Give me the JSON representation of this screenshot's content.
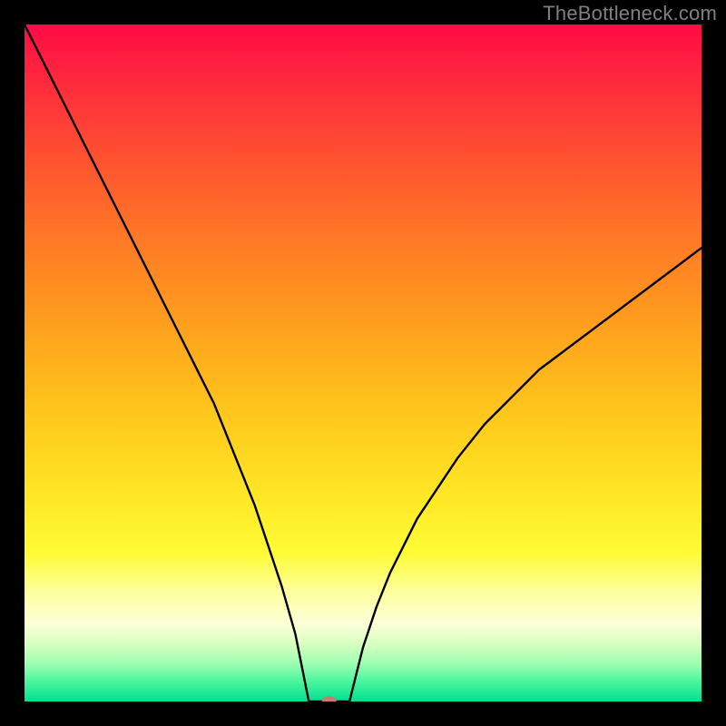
{
  "watermark": "TheBottleneck.com",
  "chart_data": {
    "type": "line",
    "title": "",
    "xlabel": "",
    "ylabel": "",
    "xlim": [
      0,
      100
    ],
    "ylim": [
      0,
      100
    ],
    "marker": {
      "x": 45,
      "y": 0,
      "color": "#cc7a6f",
      "rx": 8,
      "ry": 6
    },
    "flat_region_x": [
      42,
      48
    ],
    "curve_left": [
      {
        "x": 0,
        "y": 100
      },
      {
        "x": 2,
        "y": 96
      },
      {
        "x": 4,
        "y": 92
      },
      {
        "x": 6,
        "y": 88
      },
      {
        "x": 8,
        "y": 84
      },
      {
        "x": 10,
        "y": 80
      },
      {
        "x": 12,
        "y": 76
      },
      {
        "x": 14,
        "y": 72
      },
      {
        "x": 16,
        "y": 68
      },
      {
        "x": 18,
        "y": 64
      },
      {
        "x": 20,
        "y": 60
      },
      {
        "x": 22,
        "y": 56
      },
      {
        "x": 24,
        "y": 52
      },
      {
        "x": 26,
        "y": 48
      },
      {
        "x": 28,
        "y": 44
      },
      {
        "x": 30,
        "y": 39
      },
      {
        "x": 32,
        "y": 34
      },
      {
        "x": 34,
        "y": 29
      },
      {
        "x": 36,
        "y": 23
      },
      {
        "x": 38,
        "y": 17
      },
      {
        "x": 40,
        "y": 10
      },
      {
        "x": 42,
        "y": 0
      }
    ],
    "curve_right": [
      {
        "x": 48,
        "y": 0
      },
      {
        "x": 50,
        "y": 8
      },
      {
        "x": 52,
        "y": 14
      },
      {
        "x": 54,
        "y": 19
      },
      {
        "x": 56,
        "y": 23
      },
      {
        "x": 58,
        "y": 27
      },
      {
        "x": 60,
        "y": 30
      },
      {
        "x": 62,
        "y": 33
      },
      {
        "x": 64,
        "y": 36
      },
      {
        "x": 66,
        "y": 38.5
      },
      {
        "x": 68,
        "y": 41
      },
      {
        "x": 70,
        "y": 43
      },
      {
        "x": 72,
        "y": 45
      },
      {
        "x": 74,
        "y": 47
      },
      {
        "x": 76,
        "y": 49
      },
      {
        "x": 78,
        "y": 50.5
      },
      {
        "x": 80,
        "y": 52
      },
      {
        "x": 82,
        "y": 53.5
      },
      {
        "x": 84,
        "y": 55
      },
      {
        "x": 86,
        "y": 56.5
      },
      {
        "x": 88,
        "y": 58
      },
      {
        "x": 90,
        "y": 59.5
      },
      {
        "x": 92,
        "y": 61
      },
      {
        "x": 94,
        "y": 62.5
      },
      {
        "x": 96,
        "y": 64
      },
      {
        "x": 98,
        "y": 65.5
      },
      {
        "x": 100,
        "y": 67
      }
    ],
    "gradient_stops": [
      {
        "offset": 0.0,
        "color": "#ff0b46"
      },
      {
        "offset": 0.1,
        "color": "#ff2f3b"
      },
      {
        "offset": 0.2,
        "color": "#ff5230"
      },
      {
        "offset": 0.3,
        "color": "#ff7327"
      },
      {
        "offset": 0.4,
        "color": "#ff9220"
      },
      {
        "offset": 0.5,
        "color": "#ffb11c"
      },
      {
        "offset": 0.6,
        "color": "#ffce1d"
      },
      {
        "offset": 0.7,
        "color": "#ffe826"
      },
      {
        "offset": 0.78,
        "color": "#fffb35"
      },
      {
        "offset": 0.84,
        "color": "#fdffa0"
      },
      {
        "offset": 0.885,
        "color": "#fdffd8"
      },
      {
        "offset": 0.915,
        "color": "#d7ffc0"
      },
      {
        "offset": 0.945,
        "color": "#9bffb0"
      },
      {
        "offset": 0.97,
        "color": "#4cf59f"
      },
      {
        "offset": 1.0,
        "color": "#00e08f"
      }
    ]
  }
}
